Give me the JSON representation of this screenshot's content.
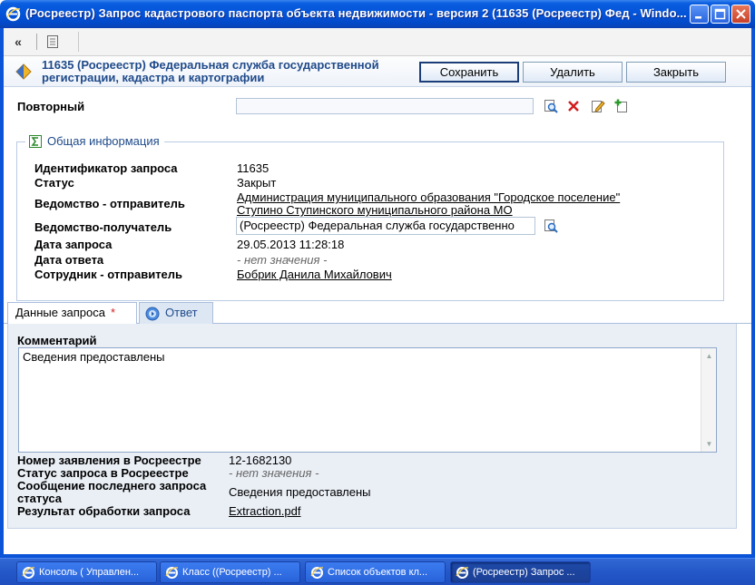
{
  "window": {
    "title": "(Росреестр) Запрос кадастрового паспорта объекта недвижимости - версия 2 (11635 (Росреестр) Фед - Windo..."
  },
  "toolbar": {
    "collapse_label": "«"
  },
  "header": {
    "title": "11635 (Росреестр) Федеральная служба государственной регистрации, кадастра и картографии",
    "save_label": "Сохранить",
    "delete_label": "Удалить",
    "close_label": "Закрыть"
  },
  "repeat": {
    "label": "Повторный",
    "value": ""
  },
  "general": {
    "legend": "Общая информация",
    "fields": {
      "request_id": {
        "label": "Идентификатор запроса",
        "value": "11635"
      },
      "status": {
        "label": "Статус",
        "value": "Закрыт"
      },
      "sender_agency": {
        "label": "Ведомство - отправитель",
        "value_line1": "Администрация муниципального образования \"Городское поселение\"",
        "value_line2": "Ступино Ступинского муниципального района МО"
      },
      "receiver_agency": {
        "label": "Ведомство-получатель",
        "value": "(Росреестр) Федеральная служба государственно"
      },
      "request_date": {
        "label": "Дата запроса",
        "value": "29.05.2013 11:28:18"
      },
      "answer_date": {
        "label": "Дата ответа",
        "value": "- нет значения -"
      },
      "sender_employee": {
        "label": "Сотрудник - отправитель",
        "value": "Бобрик Данила Михайлович"
      }
    }
  },
  "tabs": [
    {
      "label": "Данные запроса",
      "required_mark": "*"
    },
    {
      "label": "Ответ"
    }
  ],
  "request_data": {
    "comment_label": "Комментарий",
    "comment_value": "Сведения предоставлены",
    "rosreestr_number": {
      "label": "Номер заявления в Росреестре",
      "value": "12-1682130"
    },
    "rosreestr_status": {
      "label": "Статус запроса в Росреестре",
      "value": "- нет значения -"
    },
    "last_status_msg": {
      "label_line1": "Сообщение последнего запроса",
      "label_line2": "статуса",
      "value": "Сведения предоставлены"
    },
    "result": {
      "label": "Результат обработки запроса",
      "value": "Extraction.pdf"
    }
  },
  "taskbar": [
    {
      "label": "Консоль ( Управлен..."
    },
    {
      "label": "Класс ((Росреестр) ..."
    },
    {
      "label": "Список объектов кл..."
    },
    {
      "label": "(Росреестр) Запрос ..."
    }
  ],
  "colors": {
    "title_bar": "#0453d8",
    "header_text": "#1f4a8a",
    "required_star": "#d21e1e"
  }
}
